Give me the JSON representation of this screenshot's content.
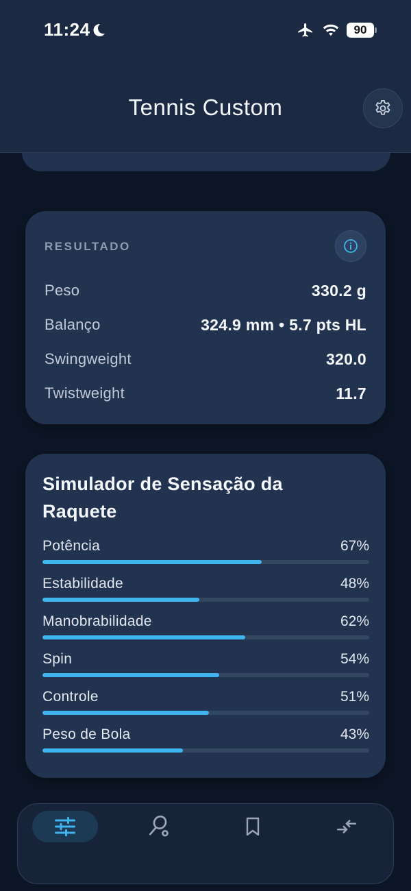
{
  "status_bar": {
    "time": "11:24",
    "battery": "90"
  },
  "header": {
    "title": "Tennis Custom"
  },
  "result": {
    "title": "RESULTADO",
    "rows": [
      {
        "label": "Peso",
        "value": "330.2 g"
      },
      {
        "label": "Balanço",
        "value": "324.9 mm • 5.7 pts HL"
      },
      {
        "label": "Swingweight",
        "value": "320.0"
      },
      {
        "label": "Twistweight",
        "value": "11.7"
      }
    ]
  },
  "simulator": {
    "title": "Simulador de Sensação da Raquete",
    "metrics": [
      {
        "label": "Potência",
        "value": "67%",
        "level": 67
      },
      {
        "label": "Estabilidade",
        "value": "48%",
        "level": 48
      },
      {
        "label": "Manobrabilidade",
        "value": "62%",
        "level": 62
      },
      {
        "label": "Spin",
        "value": "54%",
        "level": 54
      },
      {
        "label": "Controle",
        "value": "51%",
        "level": 51
      },
      {
        "label": "Peso de Bola",
        "value": "43%",
        "level": 43
      }
    ]
  },
  "colors": {
    "accent": "#3fb4ee",
    "card": "#223350",
    "background": "#0d1626"
  },
  "nav": {
    "items": [
      {
        "icon": "sliders-icon",
        "active": true
      },
      {
        "icon": "racket-icon",
        "active": false
      },
      {
        "icon": "bookmark-icon",
        "active": false
      },
      {
        "icon": "compare-arrows-icon",
        "active": false
      }
    ]
  }
}
